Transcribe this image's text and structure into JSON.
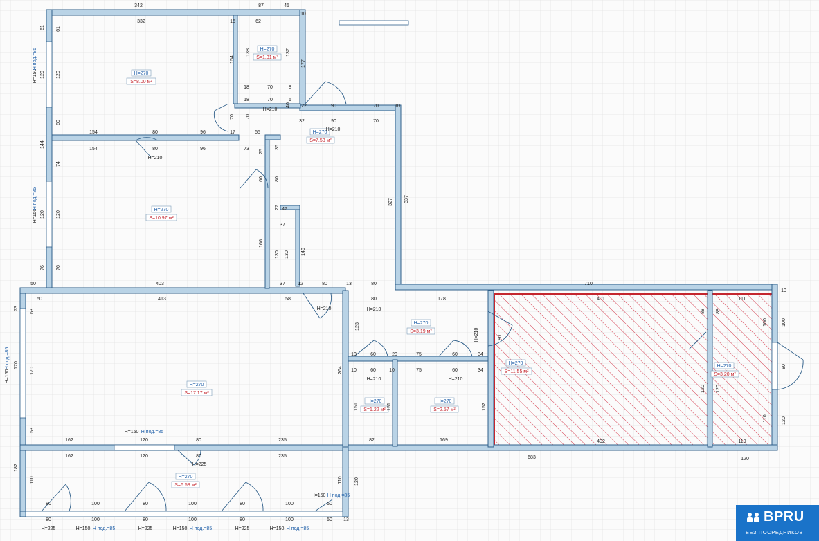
{
  "rooms": [
    {
      "id": "bedroom-1",
      "h": "H=270",
      "s": "S=8.00 м²"
    },
    {
      "id": "bathroom-1",
      "h": "H=270",
      "s": "S=1.31 м²"
    },
    {
      "id": "hall",
      "h": "H=270",
      "s": "S=7.53 м²"
    },
    {
      "id": "bedroom-2",
      "h": "H=270",
      "s": "S=10.97 м²"
    },
    {
      "id": "living-room",
      "h": "H=270",
      "s": "S=17.17 м²"
    },
    {
      "id": "corridor",
      "h": "H=270",
      "s": "S=3.19 м²"
    },
    {
      "id": "wc",
      "h": "H=270",
      "s": "S=1.22 м²"
    },
    {
      "id": "bathroom-2",
      "h": "H=270",
      "s": "S=2.57 м²"
    },
    {
      "id": "kitchen",
      "h": "H=270",
      "s": "S=11.55 м²"
    },
    {
      "id": "storage",
      "h": "H=270",
      "s": "S=3.20 м²"
    },
    {
      "id": "balcony",
      "h": "H=270",
      "s": "S=6.58 м²"
    }
  ],
  "doors": {
    "h210": "H=210",
    "h225": "H=225"
  },
  "windows": {
    "h150": "H=150",
    "sill": "H под.=85"
  },
  "dims": {
    "top_342": "342",
    "top_87": "87",
    "top_45": "45",
    "d332": "332",
    "d15": "15",
    "d62": "62",
    "d10": "10",
    "d154": "154",
    "d80": "80",
    "d96": "96",
    "d17": "17",
    "d55": "55",
    "d73": "73",
    "d25": "25",
    "d36": "36",
    "d90": "90",
    "d70": "70",
    "d32": "32",
    "d22": "22",
    "d18": "18",
    "d8": "8",
    "d6": "6",
    "d40": "40",
    "d47": "47",
    "d27": "27",
    "d37": "37",
    "d12": "12",
    "d13": "13",
    "d403": "403",
    "d413": "413",
    "d58": "58",
    "d50": "50",
    "d178": "178",
    "d710": "710",
    "d401": "401",
    "d111": "111",
    "d60": "60",
    "d20": "20",
    "d75": "75",
    "d34": "34",
    "d162": "162",
    "d120": "120",
    "d235": "235",
    "d82": "82",
    "d169": "169",
    "d402": "402",
    "d683": "683",
    "d110": "110",
    "d100": "100",
    "v61": "61",
    "v120": "120",
    "v60": "60",
    "v144": "144",
    "v74": "74",
    "v76": "76",
    "v73": "73",
    "v63": "63",
    "v170": "170",
    "v53": "53",
    "v182": "182",
    "v110": "110",
    "v154": "154",
    "v138": "138",
    "v137": "137",
    "v177": "177",
    "v327": "327",
    "v337": "337",
    "v166": "166",
    "v130": "130",
    "v140": "140",
    "v123": "123",
    "v264": "264",
    "v151": "151",
    "v152": "152",
    "v88": "88",
    "v80": "80",
    "v100": "100"
  },
  "logo": {
    "brand": "BPRU",
    "subtitle": "БЕЗ ПОСРЕДНИКОВ"
  },
  "colors": {
    "wall": "#b9d3e6",
    "wall_edge": "#2f5f8a",
    "hatch": "#d0253a",
    "grid": "#e4e4e4",
    "height_label": "#1f5fa8",
    "area_label": "#c4262e"
  }
}
